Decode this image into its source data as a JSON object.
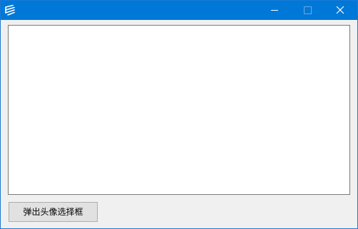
{
  "window": {
    "title": "",
    "icons": {
      "app": "app-logo-icon",
      "minimize": "minimize-icon",
      "maximize": "maximize-icon",
      "close": "close-icon"
    },
    "colors": {
      "titlebar": "#0078d7",
      "client_background": "#f0f0f0",
      "panel_background": "#ffffff",
      "button_face": "#e1e1e1"
    }
  },
  "toolbar": {
    "popup_avatar_label": "弹出头像选择框"
  }
}
